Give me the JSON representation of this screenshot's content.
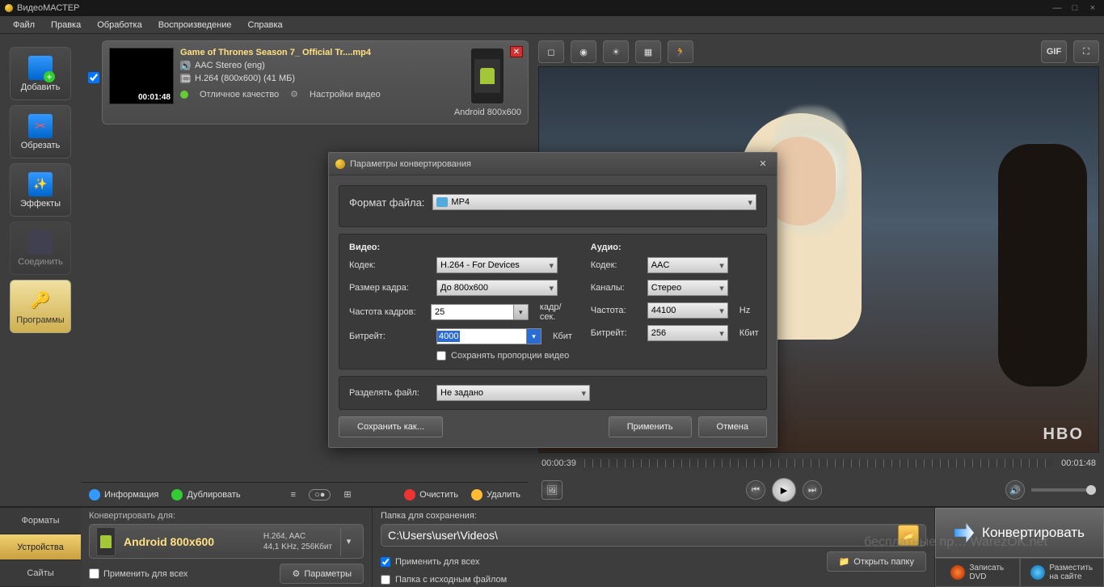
{
  "app": {
    "title": "ВидеоМАСТЕР"
  },
  "win_ctrls": {
    "min": "—",
    "max": "□",
    "close": "×"
  },
  "menu": [
    "Файл",
    "Правка",
    "Обработка",
    "Воспроизведение",
    "Справка"
  ],
  "sidebar": [
    {
      "label": "Добавить",
      "icon": "add-file-icon"
    },
    {
      "label": "Обрезать",
      "icon": "cut-icon"
    },
    {
      "label": "Эффекты",
      "icon": "effects-icon"
    },
    {
      "label": "Соединить",
      "icon": "join-icon",
      "disabled": true
    },
    {
      "label": "Программы",
      "icon": "programs-icon",
      "active": true
    }
  ],
  "file": {
    "title": "Game of Thrones Season 7_ Official Tr....mp4",
    "audio": "AAC Stereo (eng)",
    "video": "H.264 (800x600) (41 МБ)",
    "duration": "00:01:48",
    "quality": "Отличное качество",
    "settings": "Настройки видео",
    "target": "Android 800x600",
    "checked": true
  },
  "list_toolbar": {
    "info": "Информация",
    "duplicate": "Дублировать",
    "clear": "Очистить",
    "delete": "Удалить"
  },
  "preview": {
    "time_current": "00:00:39",
    "time_total": "00:01:48",
    "watermark": "HBO",
    "gif_btn": "GIF"
  },
  "dialog": {
    "title": "Параметры конвертирования",
    "file_format_label": "Формат  файла:",
    "file_format_value": "MP4",
    "video_header": "Видео:",
    "audio_header": "Аудио:",
    "v_codec_label": "Кодек:",
    "v_codec": "H.264 - For Devices",
    "v_size_label": "Размер кадра:",
    "v_size": "До 800x600",
    "v_fps_label": "Частота кадров:",
    "v_fps": "25",
    "v_fps_unit": "кадр/сек.",
    "v_bitrate_label": "Битрейт:",
    "v_bitrate": "4000",
    "v_bitrate_unit": "Кбит",
    "keep_aspect": "Сохранять пропорции видео",
    "a_codec_label": "Кодек:",
    "a_codec": "AAC",
    "a_channels_label": "Каналы:",
    "a_channels": "Стерео",
    "a_freq_label": "Частота:",
    "a_freq": "44100",
    "a_freq_unit": "Hz",
    "a_bitrate_label": "Битрейт:",
    "a_bitrate": "256",
    "a_bitrate_unit": "Кбит",
    "split_label": "Разделять файл:",
    "split_value": "Не задано",
    "save_as": "Сохранить как...",
    "apply": "Применить",
    "cancel": "Отмена"
  },
  "bottom": {
    "tab_formats": "Форматы",
    "tab_devices": "Устройства",
    "tab_sites": "Сайты",
    "convert_for": "Конвертировать для:",
    "format_main": "Android 800x600",
    "format_sub1": "H.264, AAC",
    "format_sub2": "44,1 KHz, 256Кбит",
    "apply_all": "Применить для всех",
    "params": "Параметры",
    "folder_label": "Папка для сохранения:",
    "folder_path": "C:\\Users\\user\\Videos\\",
    "open_folder": "Открыть папку",
    "source_folder": "Папка с исходным файлом",
    "convert": "Конвертировать",
    "burn_dvd_l1": "Записать",
    "burn_dvd_l2": "DVD",
    "publish_l1": "Разместить",
    "publish_l2": "на сайте"
  },
  "watermark_text": "бесплатные пр… WarezOK.net"
}
